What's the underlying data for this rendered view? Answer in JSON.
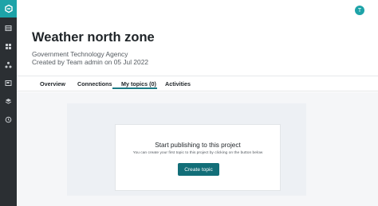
{
  "header": {
    "title": "Weather north zone",
    "agency": "Government Technology Agency",
    "created": "Created by Team admin on 05 Jul 2022"
  },
  "user": {
    "avatar_letter": "T"
  },
  "sidebar": {
    "icons": [
      "logo-icon",
      "datasets-icon",
      "projects-icon",
      "sharing-icon",
      "topics-icon",
      "layers-icon",
      "history-icon"
    ]
  },
  "tabs": [
    {
      "label": "Overview"
    },
    {
      "label": "Connections"
    },
    {
      "label": "My topics (0)",
      "active": true
    },
    {
      "label": "Activities"
    }
  ],
  "empty_state": {
    "title": "Start publishing to this project",
    "description": "You can create your first topic to this project by clicking on the button below",
    "button_label": "Create topic"
  },
  "colors": {
    "sidebar": "#2b2f33",
    "brand": "#1da3a8",
    "button": "#126e78",
    "tab_active": "#1c7a85"
  }
}
